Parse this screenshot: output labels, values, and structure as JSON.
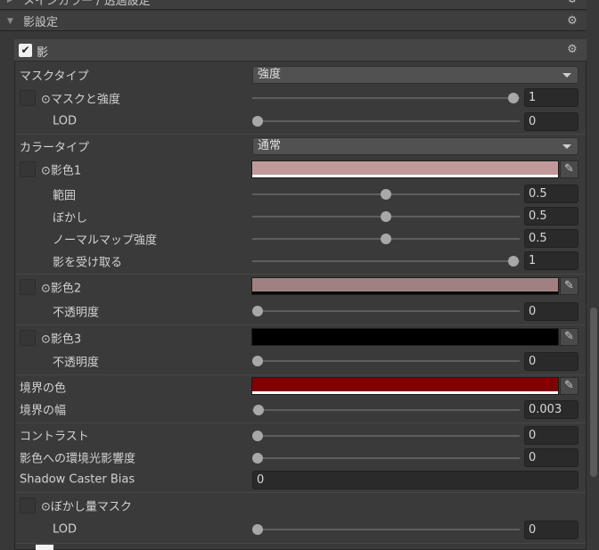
{
  "sections": {
    "prev_title": "メインカラー / 透過設定",
    "shadow_settings_title": "影設定"
  },
  "panel": {
    "title": "影",
    "enabled": true
  },
  "rows": {
    "mask_type": {
      "label": "マスクタイプ",
      "value": "強度"
    },
    "mask_strength": {
      "label": "マスクと強度",
      "value": "1",
      "slider": 1.0
    },
    "lod1": {
      "label": "LOD",
      "value": "0",
      "slider": 0.0
    },
    "color_type": {
      "label": "カラータイプ",
      "value": "通常"
    },
    "shadow_color1": {
      "label": "影色1",
      "color": "#c09a9a"
    },
    "range": {
      "label": "範囲",
      "value": "0.5",
      "slider": 0.5
    },
    "blur": {
      "label": "ぼかし",
      "value": "0.5",
      "slider": 0.5
    },
    "normal_map": {
      "label": "ノーマルマップ強度",
      "value": "0.5",
      "slider": 0.5
    },
    "receive_shadow": {
      "label": "影を受け取る",
      "value": "1",
      "slider": 1.0
    },
    "shadow_color2": {
      "label": "影色2",
      "color": "#a08080"
    },
    "opacity2": {
      "label": "不透明度",
      "value": "0",
      "slider": 0.0
    },
    "shadow_color3": {
      "label": "影色3",
      "color": "#000000"
    },
    "opacity3": {
      "label": "不透明度",
      "value": "0",
      "slider": 0.0
    },
    "border_color": {
      "label": "境界の色",
      "color": "#7e0000"
    },
    "border_width": {
      "label": "境界の幅",
      "value": "0.003",
      "slider": 0.003
    },
    "contrast": {
      "label": "コントラスト",
      "value": "0",
      "slider": 0.0
    },
    "env_light": {
      "label": "影色への環境光影響度",
      "value": "0",
      "slider": 0.0
    },
    "caster_bias": {
      "label": "Shadow Caster Bias",
      "value": "0"
    },
    "blur_mask": {
      "label": "ぼかし量マスク"
    },
    "lod2": {
      "label": "LOD",
      "value": "0",
      "slider": 0.0
    }
  },
  "icons": {
    "gear": "gear-icon",
    "eyedropper": "eyedropper-icon",
    "texture_slot": "texture-slot-icon"
  }
}
